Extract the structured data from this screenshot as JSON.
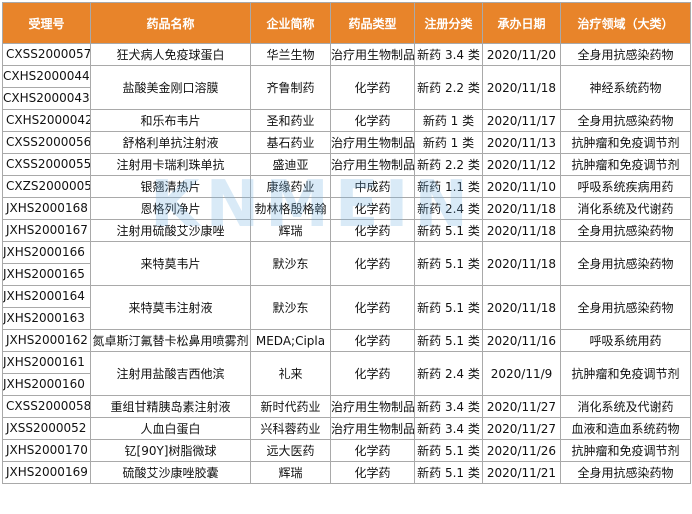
{
  "headers": [
    "受理号",
    "药品名称",
    "企业简称",
    "药品类型",
    "注册分类",
    "承办日期",
    "治疗领域（大类）"
  ],
  "watermark": "KNMEIN",
  "colors": {
    "header_bg": "#e8842a",
    "header_text": "#ffffff",
    "border": "#a9a9a9"
  },
  "rows": [
    {
      "ids": [
        "CXSS2000057"
      ],
      "name": "狂犬病人免疫球蛋白",
      "company": "华兰生物",
      "type": "治疗用生物制品",
      "class": "新药 3.4 类",
      "date": "2020/11/20",
      "area": "全身用抗感染药物"
    },
    {
      "ids": [
        "CXHS2000044",
        "CXHS2000043"
      ],
      "name": "盐酸美金刚口溶膜",
      "company": "齐鲁制药",
      "type": "化学药",
      "class": "新药 2.2 类",
      "date": "2020/11/18",
      "area": "神经系统药物"
    },
    {
      "ids": [
        "CXHS2000042"
      ],
      "name": "和乐布韦片",
      "company": "圣和药业",
      "type": "化学药",
      "class": "新药 1 类",
      "date": "2020/11/17",
      "area": "全身用抗感染药物"
    },
    {
      "ids": [
        "CXSS2000056"
      ],
      "name": "舒格利单抗注射液",
      "company": "基石药业",
      "type": "治疗用生物制品",
      "class": "新药 1 类",
      "date": "2020/11/13",
      "area": "抗肿瘤和免疫调节剂"
    },
    {
      "ids": [
        "CXSS2000055"
      ],
      "name": "注射用卡瑞利珠单抗",
      "company": "盛迪亚",
      "type": "治疗用生物制品",
      "class": "新药 2.2 类",
      "date": "2020/11/12",
      "area": "抗肿瘤和免疫调节剂"
    },
    {
      "ids": [
        "CXZS2000005"
      ],
      "name": "银翘清热片",
      "company": "康缘药业",
      "type": "中成药",
      "class": "新药 1.1 类",
      "date": "2020/11/10",
      "area": "呼吸系统疾病用药"
    },
    {
      "ids": [
        "JXHS2000168"
      ],
      "name": "恩格列净片",
      "company": "勃林格殷格翰",
      "type": "化学药",
      "class": "新药 2.4 类",
      "date": "2020/11/18",
      "area": "消化系统及代谢药"
    },
    {
      "ids": [
        "JXHS2000167"
      ],
      "name": "注射用硫酸艾沙康唑",
      "company": "辉瑞",
      "type": "化学药",
      "class": "新药 5.1 类",
      "date": "2020/11/18",
      "area": "全身用抗感染药物"
    },
    {
      "ids": [
        "JXHS2000166",
        "JXHS2000165"
      ],
      "name": "来特莫韦片",
      "company": "默沙东",
      "type": "化学药",
      "class": "新药 5.1 类",
      "date": "2020/11/18",
      "area": "全身用抗感染药物"
    },
    {
      "ids": [
        "JXHS2000164",
        "JXHS2000163"
      ],
      "name": "来特莫韦注射液",
      "company": "默沙东",
      "type": "化学药",
      "class": "新药 5.1 类",
      "date": "2020/11/18",
      "area": "全身用抗感染药物"
    },
    {
      "ids": [
        "JXHS2000162"
      ],
      "name": "氮卓斯汀氟替卡松鼻用喷雾剂",
      "company": "MEDA;Cipla",
      "type": "化学药",
      "class": "新药 5.1 类",
      "date": "2020/11/16",
      "area": "呼吸系统用药"
    },
    {
      "ids": [
        "JXHS2000161",
        "JXHS2000160"
      ],
      "name": "注射用盐酸吉西他滨",
      "company": "礼来",
      "type": "化学药",
      "class": "新药 2.4 类",
      "date": "2020/11/9",
      "area": "抗肿瘤和免疫调节剂"
    },
    {
      "ids": [
        "CXSS2000058"
      ],
      "name": "重组甘精胰岛素注射液",
      "company": "新时代药业",
      "type": "治疗用生物制品",
      "class": "新药 3.4 类",
      "date": "2020/11/27",
      "area": "消化系统及代谢药"
    },
    {
      "ids": [
        "JXSS2000052"
      ],
      "name": "人血白蛋白",
      "company": "兴科蓉药业",
      "type": "治疗用生物制品",
      "class": "新药 3.4 类",
      "date": "2020/11/27",
      "area": "血液和造血系统药物"
    },
    {
      "ids": [
        "JXHS2000170"
      ],
      "name": "钇[90Y]树脂微球",
      "company": "远大医药",
      "type": "化学药",
      "class": "新药 5.1 类",
      "date": "2020/11/26",
      "area": "抗肿瘤和免疫调节剂"
    },
    {
      "ids": [
        "JXHS2000169"
      ],
      "name": "硫酸艾沙康唑胶囊",
      "company": "辉瑞",
      "type": "化学药",
      "class": "新药 5.1 类",
      "date": "2020/11/21",
      "area": "全身用抗感染药物"
    }
  ]
}
